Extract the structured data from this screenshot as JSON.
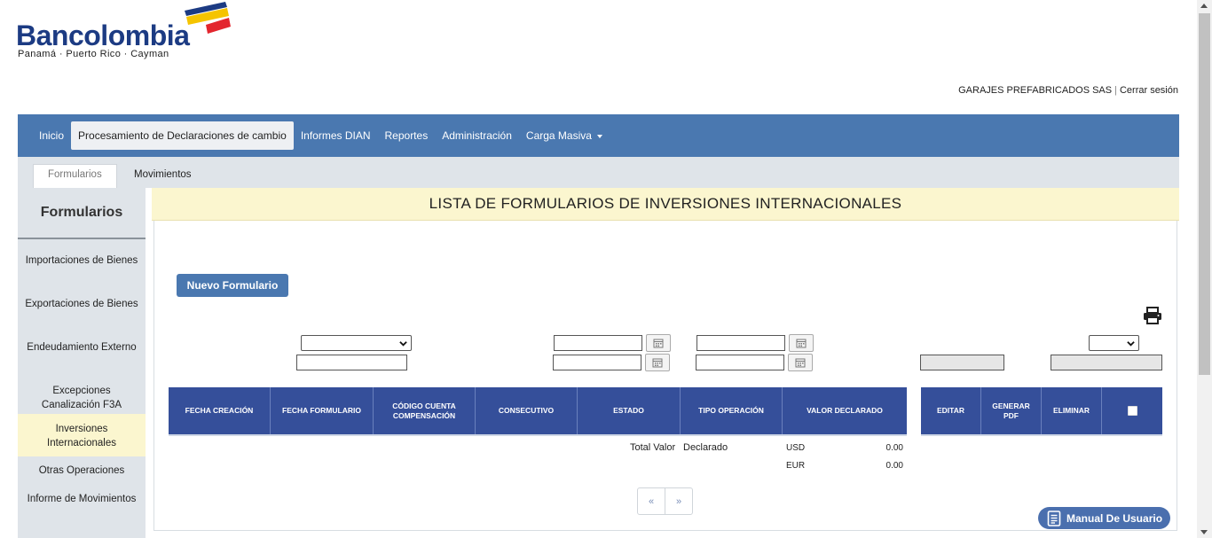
{
  "brand": {
    "name": "Bancolombia",
    "subtitle": "Panamá · Puerto Rico · Cayman",
    "colors": {
      "blue": "#1c3b83",
      "yellow": "#f5c400",
      "red": "#e3262e"
    }
  },
  "user": {
    "company": "GARAJES PREFABRICADOS SAS",
    "separator": "|",
    "logout": "Cerrar sesión"
  },
  "nav": {
    "items": [
      {
        "label": "Inicio"
      },
      {
        "label": "Procesamiento de Declaraciones de cambio",
        "active": true
      },
      {
        "label": "Informes DIAN"
      },
      {
        "label": "Reportes"
      },
      {
        "label": "Administración"
      },
      {
        "label": "Carga Masiva",
        "dropdown": true
      }
    ]
  },
  "subtabs": [
    {
      "label": "Formularios",
      "active": true
    },
    {
      "label": "Movimientos"
    }
  ],
  "sidebar": {
    "title": "Formularios",
    "items": [
      {
        "label": "Importaciones de Bienes"
      },
      {
        "label": "Exportaciones de Bienes"
      },
      {
        "label": "Endeudamiento Externo"
      },
      {
        "label": "Excepciones Canalización F3A"
      },
      {
        "label": "Inversiones Internacionales",
        "active": true
      },
      {
        "label": "Otras Operaciones"
      },
      {
        "label": "Informe de Movimientos"
      }
    ]
  },
  "page": {
    "title": "LISTA DE FORMULARIOS DE INVERSIONES INTERNACIONALES",
    "new_button": "Nuevo Formulario"
  },
  "table": {
    "headers": [
      "FECHA CREACIÓN",
      "FECHA FORMULARIO",
      "CÓDIGO CUENTA COMPENSACIÓN",
      "CONSECUTIVO",
      "ESTADO",
      "TIPO OPERACIÓN",
      "VALOR DECLARADO"
    ],
    "action_headers": [
      "EDITAR",
      "GENERAR PDF",
      "ELIMINAR"
    ]
  },
  "totals": {
    "label_1": "Total Valor",
    "label_2": "Declarado",
    "rows": [
      {
        "currency": "USD",
        "amount": "0.00"
      },
      {
        "currency": "EUR",
        "amount": "0.00"
      }
    ]
  },
  "pager": {
    "prev": "«",
    "next": "»"
  },
  "manual": {
    "label": "Manual De Usuario"
  }
}
